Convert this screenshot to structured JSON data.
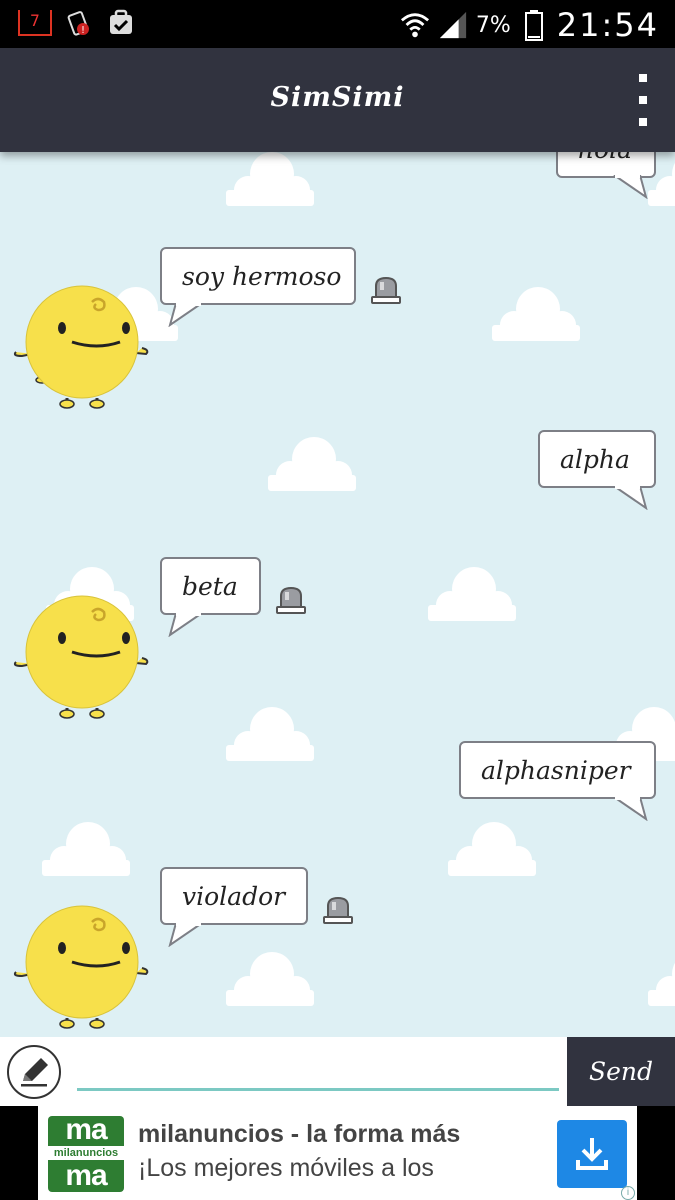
{
  "status_bar": {
    "notification_badge": "7",
    "battery_percent": "7%",
    "time": "21:54"
  },
  "app_bar": {
    "title": "SimSimi"
  },
  "chat": {
    "messages": [
      {
        "sender": "user",
        "text": "hola"
      },
      {
        "sender": "simsimi",
        "text": "soy hermoso"
      },
      {
        "sender": "user",
        "text": "alpha"
      },
      {
        "sender": "simsimi",
        "text": "beta"
      },
      {
        "sender": "user",
        "text": "alphasniper"
      },
      {
        "sender": "simsimi",
        "text": "violador"
      }
    ]
  },
  "input": {
    "value": "",
    "send_label": "Send"
  },
  "ad": {
    "logo_top": "ma",
    "logo_middle": "milanuncios",
    "logo_bottom": "ma",
    "title": "milanuncios - la forma más",
    "subtitle": "¡Los mejores móviles a los",
    "info": "i"
  },
  "colors": {
    "app_bar": "#31333f",
    "chat_background": "#def0f4",
    "input_underline": "#7cc9c3",
    "simsimi_yellow": "#f7e04b",
    "ad_download": "#1e88e5"
  }
}
